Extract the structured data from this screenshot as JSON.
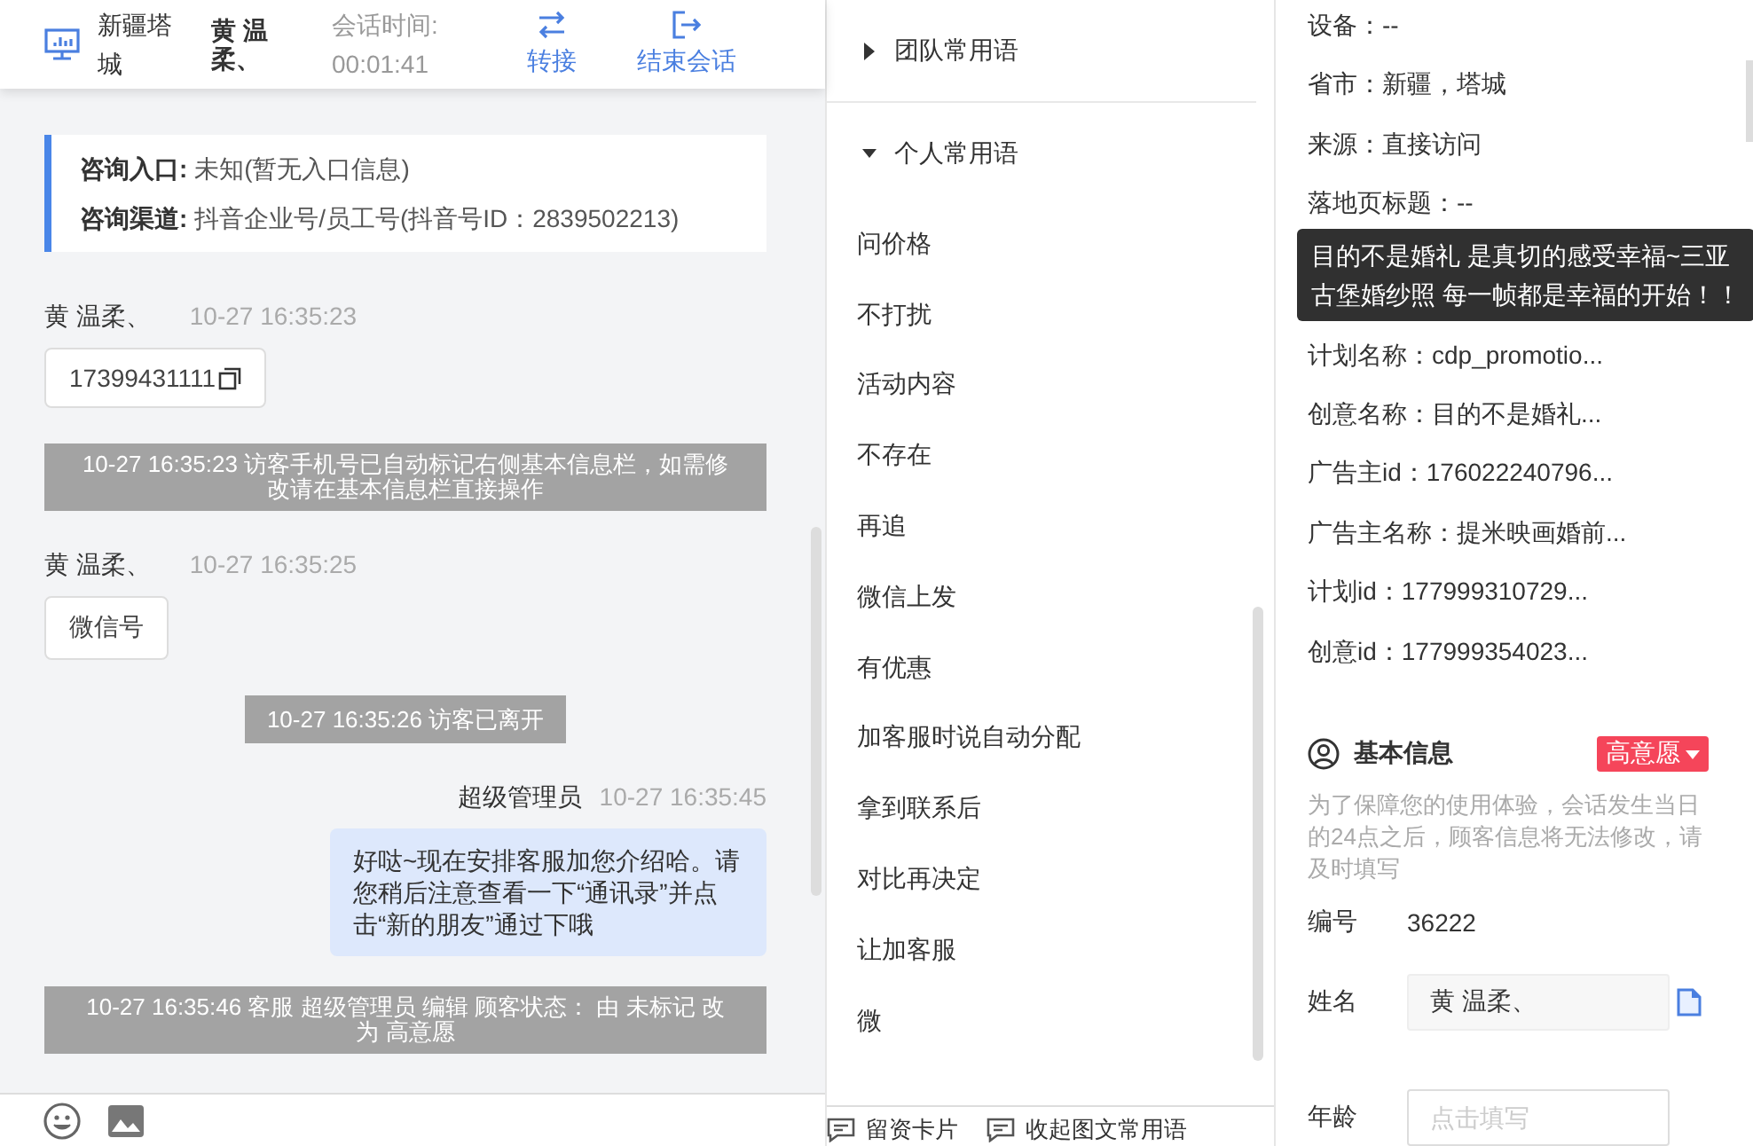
{
  "chat_header": {
    "location": "新疆塔城",
    "visitor": "黄 温柔、",
    "timer_label": "会话时间:",
    "timer": "00:01:41",
    "actions": [
      {
        "label": "转接",
        "kind": "transfer"
      },
      {
        "label": "结束会话",
        "kind": "end"
      }
    ]
  },
  "chat": {
    "source_card": [
      {
        "label": "咨询入口:",
        "value": "未知(暂无入口信息)"
      },
      {
        "label": "咨询渠道:",
        "value": "抖音企业号/员工号(抖音号ID：2839502213)"
      }
    ],
    "messages": [
      {
        "kind": "visitor",
        "sender": "黄 温柔、",
        "time": "10-27 16:35:23",
        "text": "17399431111",
        "copyable": true
      },
      {
        "kind": "system",
        "text": "10-27 16:35:23 访客手机号已自动标记右侧基本信息栏，如需修改请在基本信息栏直接操作",
        "wide": true
      },
      {
        "kind": "visitor",
        "sender": "黄 温柔、",
        "time": "10-27 16:35:25",
        "text": "微信号",
        "copyable": false
      },
      {
        "kind": "system",
        "text": "10-27 16:35:26 访客已离开",
        "wide": false
      },
      {
        "kind": "agent",
        "sender": "超级管理员",
        "time": "10-27 16:35:45",
        "text": "好哒~现在安排客服加您介绍哈。请您稍后注意查看一下“通讯录”并点击“新的朋友”通过下哦"
      },
      {
        "kind": "system",
        "text": "10-27 16:35:46 客服 超级管理员 编辑 顾客状态： 由 未标记 改为 高意愿",
        "wide": true
      }
    ]
  },
  "quick_phrases": {
    "groups": [
      {
        "label": "团队常用语",
        "expanded": false
      },
      {
        "label": "个人常用语",
        "expanded": true
      }
    ],
    "items": [
      "问价格",
      "不打扰",
      "活动内容",
      "不存在",
      "再追",
      "微信上发",
      "有优惠",
      "加客服时说自动分配",
      "拿到联系后",
      "对比再决定",
      "让加客服",
      "微"
    ],
    "footer": [
      "留资卡片",
      "收起图文常用语"
    ]
  },
  "visitor_info": {
    "fields": [
      {
        "text": "设备：--"
      },
      {
        "text": "省市：新疆，塔城"
      },
      {
        "text": "来源：直接访问"
      },
      {
        "text": "落地页标题：--"
      },
      {
        "text": "计划名称：cdp_promotio..."
      },
      {
        "text": "创意名称：目的不是婚礼..."
      },
      {
        "text": "广告主id：176022240796..."
      },
      {
        "text": "广告主名称：提米映画婚前..."
      },
      {
        "text": "计划id：177999310729..."
      },
      {
        "text": "创意id：177999354023..."
      }
    ],
    "tooltip": "目的不是婚礼 是真切的感受幸福~三亚古堡婚纱照 每一帧都是幸福的开始！！",
    "basic_info": {
      "title": "基本信息",
      "intent_tag": "高意愿",
      "notice": "为了保障您的使用体验，会话发生当日的24点之后，顾客信息将无法修改，请及时填写",
      "rows": [
        {
          "kind": "text",
          "label": "编号",
          "value": "36222"
        },
        {
          "kind": "field",
          "label": "姓名",
          "value": "黄 温柔、",
          "copyable": true
        },
        {
          "kind": "field",
          "label": "年龄",
          "placeholder": "点击填写",
          "copyable": false
        }
      ]
    }
  }
}
